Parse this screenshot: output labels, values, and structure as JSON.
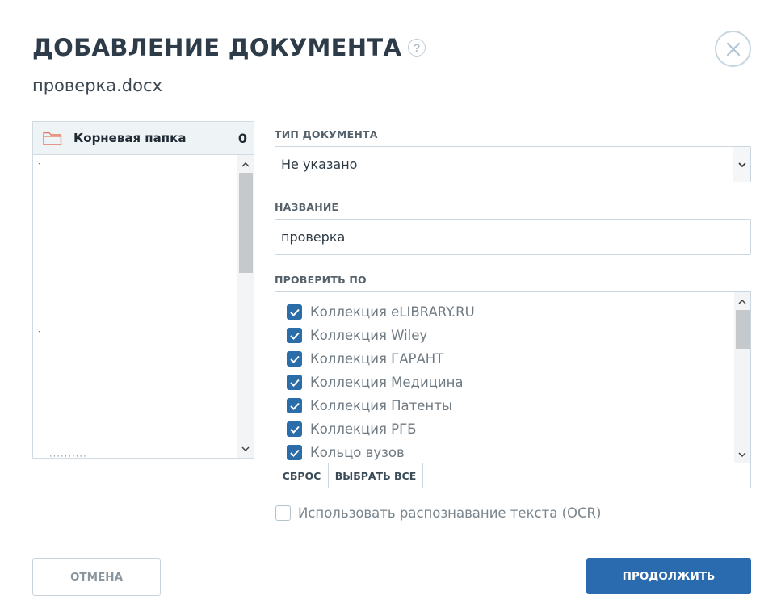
{
  "dialog": {
    "title": "ДОБАВЛЕНИЕ ДОКУМЕНТА",
    "help_glyph": "?",
    "filename": "проверка.docx"
  },
  "folders": {
    "root_name": "Корневая папка",
    "root_count": "0"
  },
  "form": {
    "doc_type_label": "ТИП ДОКУМЕНТА",
    "doc_type_value": "Не указано",
    "name_label": "НАЗВАНИЕ",
    "name_value": "проверка",
    "check_label": "ПРОВЕРИТЬ ПО",
    "collections": [
      {
        "label": "Коллекция eLIBRARY.RU",
        "checked": true
      },
      {
        "label": "Коллекция Wiley",
        "checked": true
      },
      {
        "label": "Коллекция ГАРАНТ",
        "checked": true
      },
      {
        "label": "Коллекция Медицина",
        "checked": true
      },
      {
        "label": "Коллекция Патенты",
        "checked": true
      },
      {
        "label": "Коллекция РГБ",
        "checked": true
      },
      {
        "label": "Кольцо вузов",
        "checked": true
      }
    ],
    "reset_label": "СБРОС",
    "select_all_label": "ВЫБРАТЬ ВСЕ",
    "ocr_label": "Использовать распознавание текста (OCR)",
    "ocr_checked": false
  },
  "buttons": {
    "cancel": "ОТМЕНА",
    "continue": "ПРОДОЛЖИТЬ"
  },
  "colors": {
    "accent": "#2a6aae",
    "checkbox": "#2a6da8",
    "folder_icon": "#e07a5f"
  }
}
